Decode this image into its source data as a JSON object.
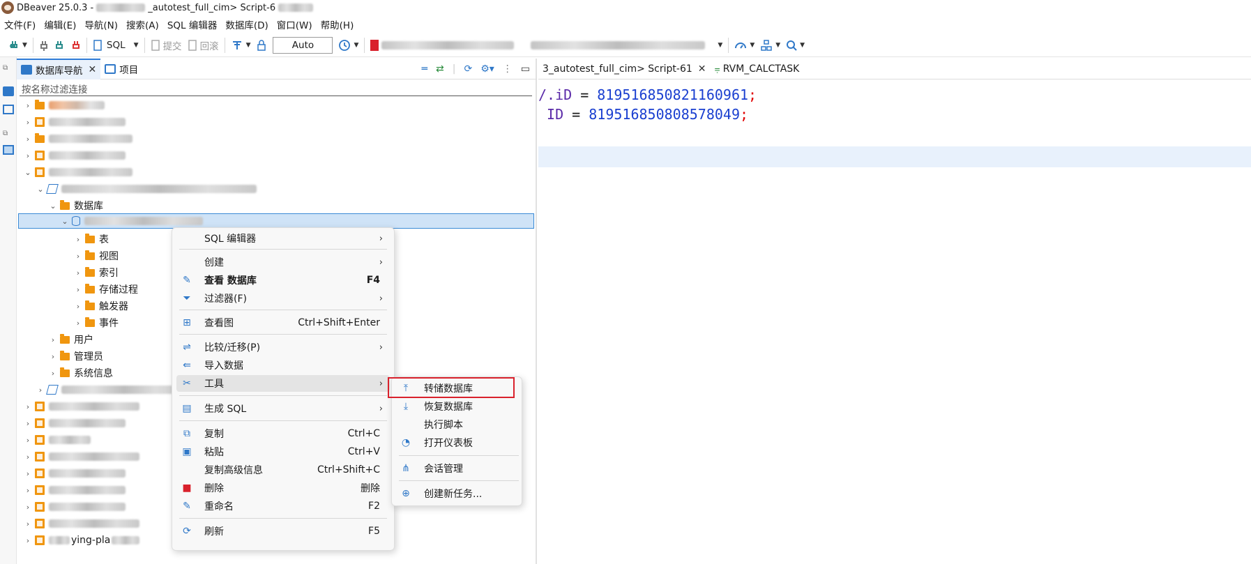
{
  "window": {
    "title_prefix": "DBeaver 25.0.3 - ",
    "title_suffix": "_autotest_full_cim> Script-6"
  },
  "menu": [
    "文件(F)",
    "编辑(E)",
    "导航(N)",
    "搜索(A)",
    "SQL 编辑器",
    "数据库(D)",
    "窗口(W)",
    "帮助(H)"
  ],
  "toolbar": {
    "sql": "SQL",
    "commit": "提交",
    "rollback": "回滚",
    "txn_mode": "Auto"
  },
  "nav": {
    "tab_db_navigator": "数据库导航",
    "tab_project": "项目",
    "filter_placeholder": "按名称过滤连接",
    "databases_label": "数据库",
    "children": [
      "表",
      "视图",
      "索引",
      "存储过程",
      "触发器",
      "事件"
    ],
    "users": "用户",
    "admins": "管理员",
    "sysinfo": "系统信息",
    "partial_name": "ying-pla"
  },
  "editor": {
    "tab1": "3_autotest_full_cim> Script-61",
    "tab2": "RVM_CALCTASK",
    "line1": {
      "col": "/.iD",
      "op": " = ",
      "val": "819516850821160961",
      "end": ";"
    },
    "line2": {
      "col": " ID",
      "op": " = ",
      "val": "819516850808578049",
      "end": ";"
    }
  },
  "context_menu": {
    "sql_editor": "SQL 编辑器",
    "create": "创建",
    "view_db": "查看 数据库",
    "view_db_sc": "F4",
    "filter": "过滤器(F)",
    "view_diagram": "查看图",
    "view_diagram_sc": "Ctrl+Shift+Enter",
    "compare": "比较/迁移(P)",
    "import": "导入数据",
    "tools": "工具",
    "gen_sql": "生成 SQL",
    "copy": "复制",
    "copy_sc": "Ctrl+C",
    "paste": "粘贴",
    "paste_sc": "Ctrl+V",
    "copy_adv": "复制高级信息",
    "copy_adv_sc": "Ctrl+Shift+C",
    "delete": "删除",
    "delete_sc": "删除",
    "rename": "重命名",
    "rename_sc": "F2",
    "refresh": "刷新",
    "refresh_sc": "F5"
  },
  "submenu": {
    "dump": "转储数据库",
    "restore": "恢复数据库",
    "exec_script": "执行脚本",
    "dashboard": "打开仪表板",
    "session": "会话管理",
    "new_task": "创建新任务..."
  },
  "colors": {
    "highlight_border": "#d9212c",
    "accent": "#2f7bd6",
    "folder": "#f0960f"
  }
}
